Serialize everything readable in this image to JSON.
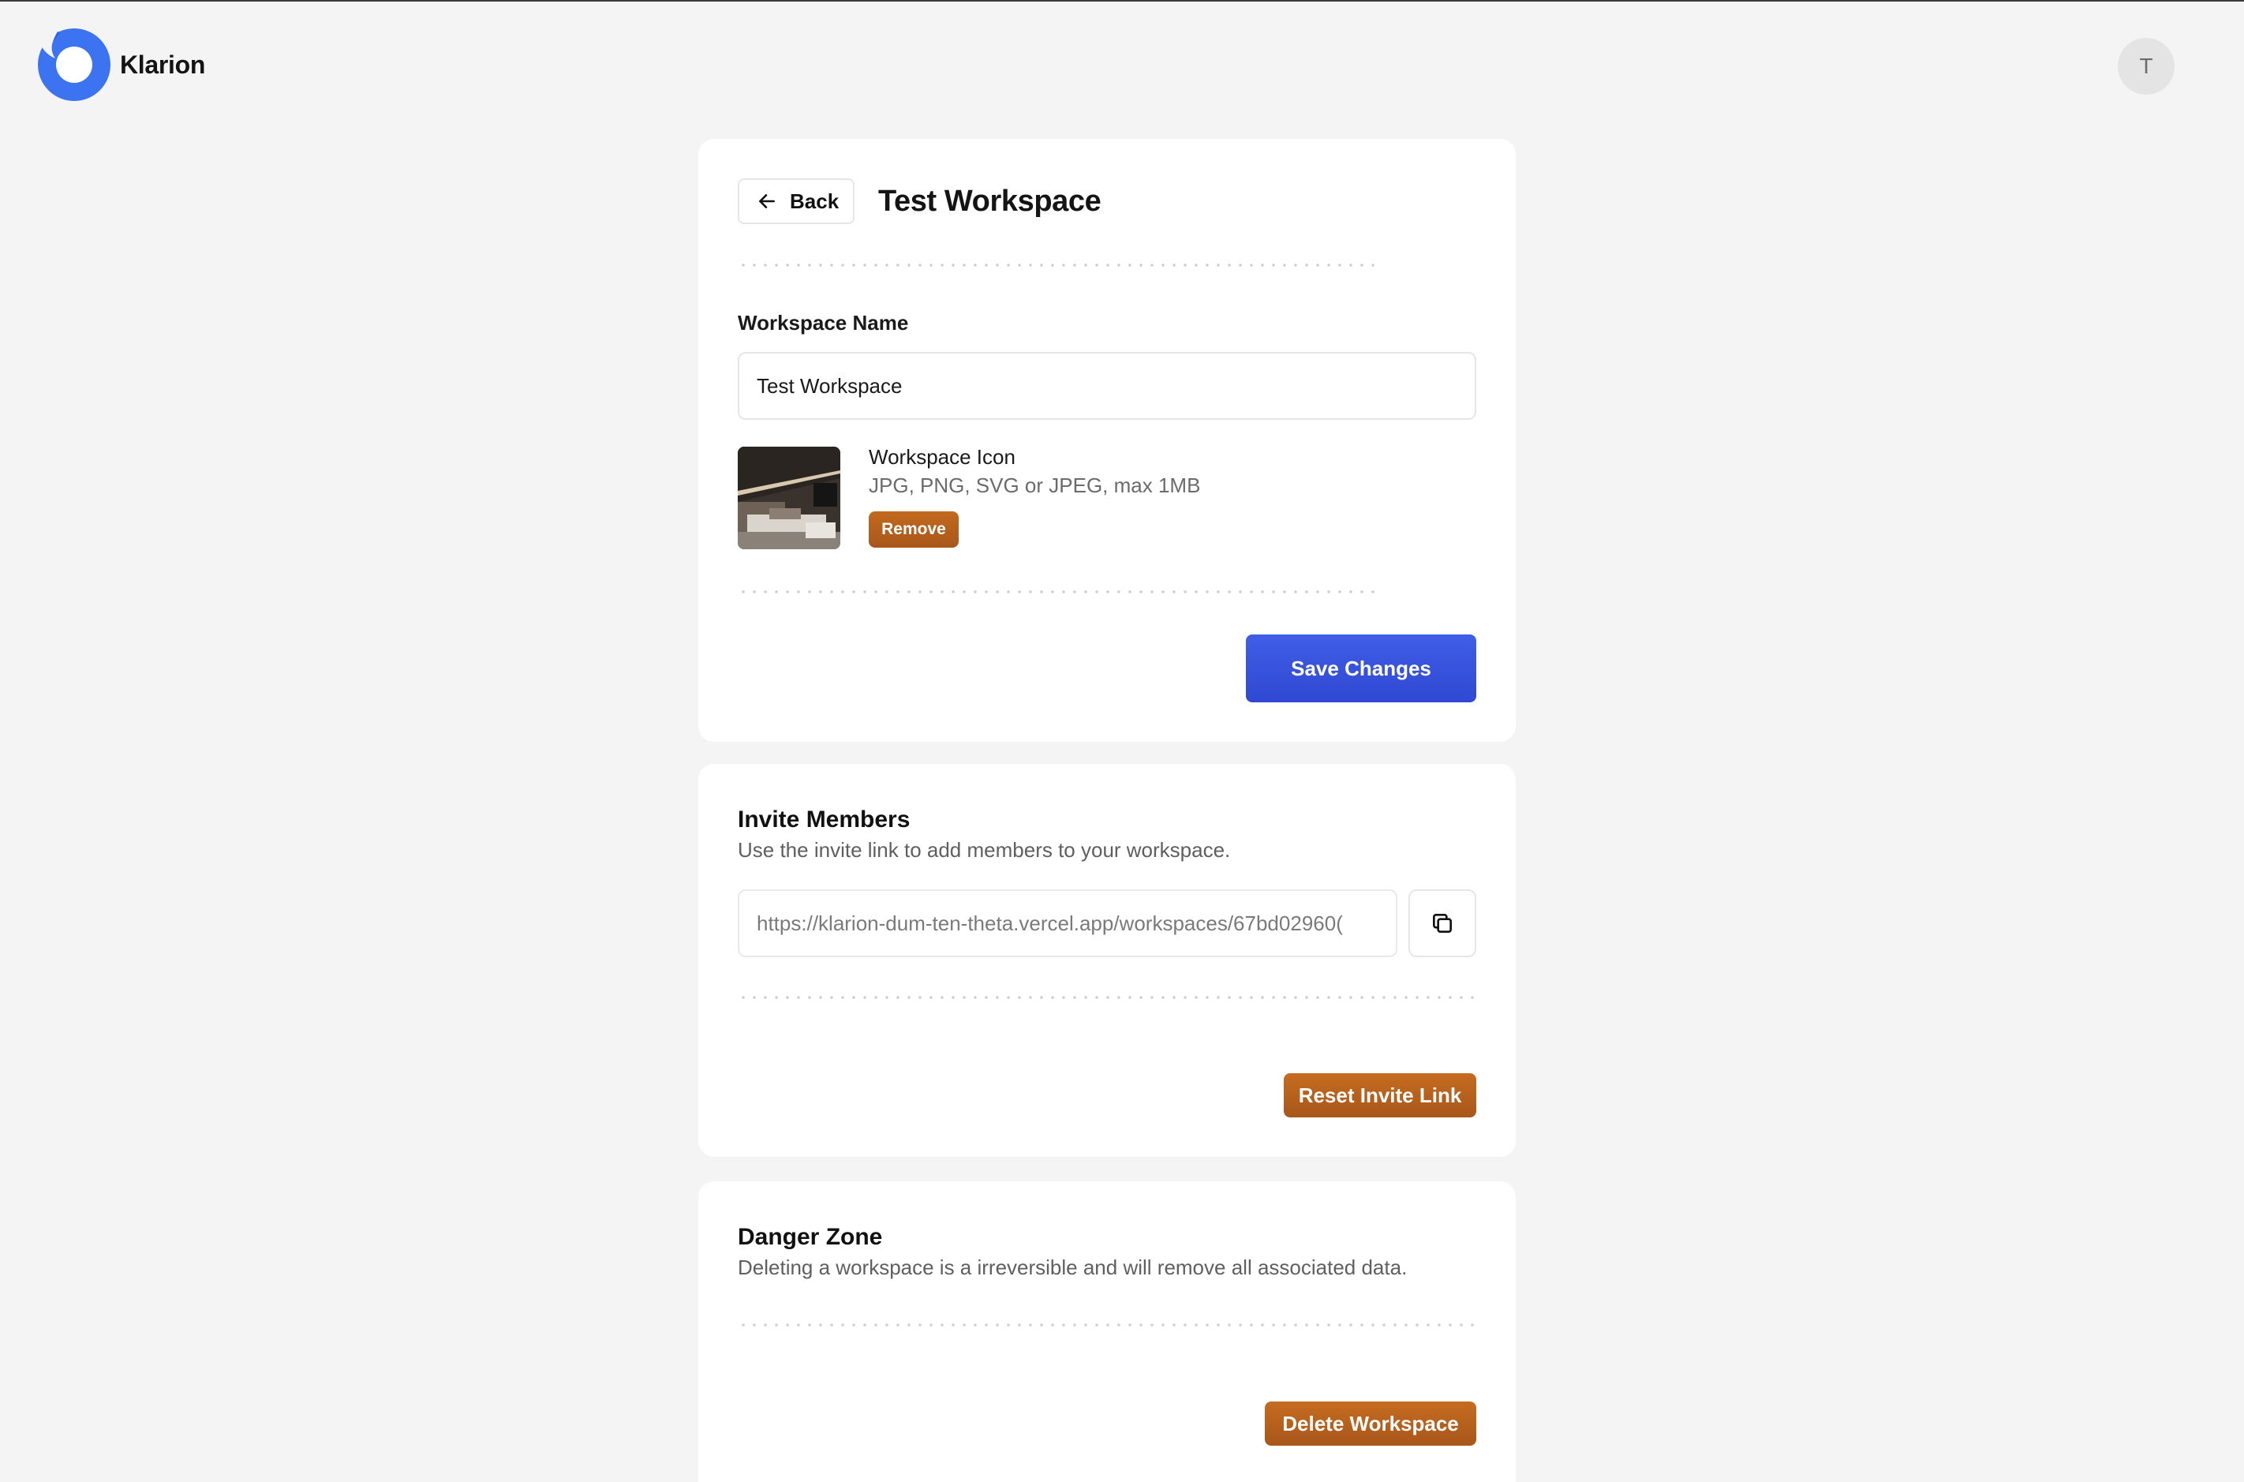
{
  "app": {
    "name": "Klarion",
    "brand_color": "#3b73f0"
  },
  "user": {
    "avatar_initial": "T"
  },
  "workspace": {
    "back_label": "Back",
    "title": "Test Workspace",
    "name_label": "Workspace Name",
    "name_value": "Test Workspace",
    "icon_title": "Workspace Icon",
    "icon_hint": "JPG, PNG, SVG or JPEG, max 1MB",
    "remove_label": "Remove",
    "save_label": "Save Changes"
  },
  "invite": {
    "title": "Invite Members",
    "description": "Use the invite link to add members to your workspace.",
    "link_value": "https://klarion-dum-ten-theta.vercel.app/workspaces/67bd02960(",
    "copy_icon": "copy-icon",
    "reset_label": "Reset Invite Link"
  },
  "danger": {
    "title": "Danger Zone",
    "description": "Deleting a workspace is a irreversible and will remove all associated data.",
    "delete_label": "Delete Workspace"
  },
  "colors": {
    "primary_button": "#3a53dc",
    "warning_button": "#b65f1c",
    "background": "#f4f4f4"
  }
}
